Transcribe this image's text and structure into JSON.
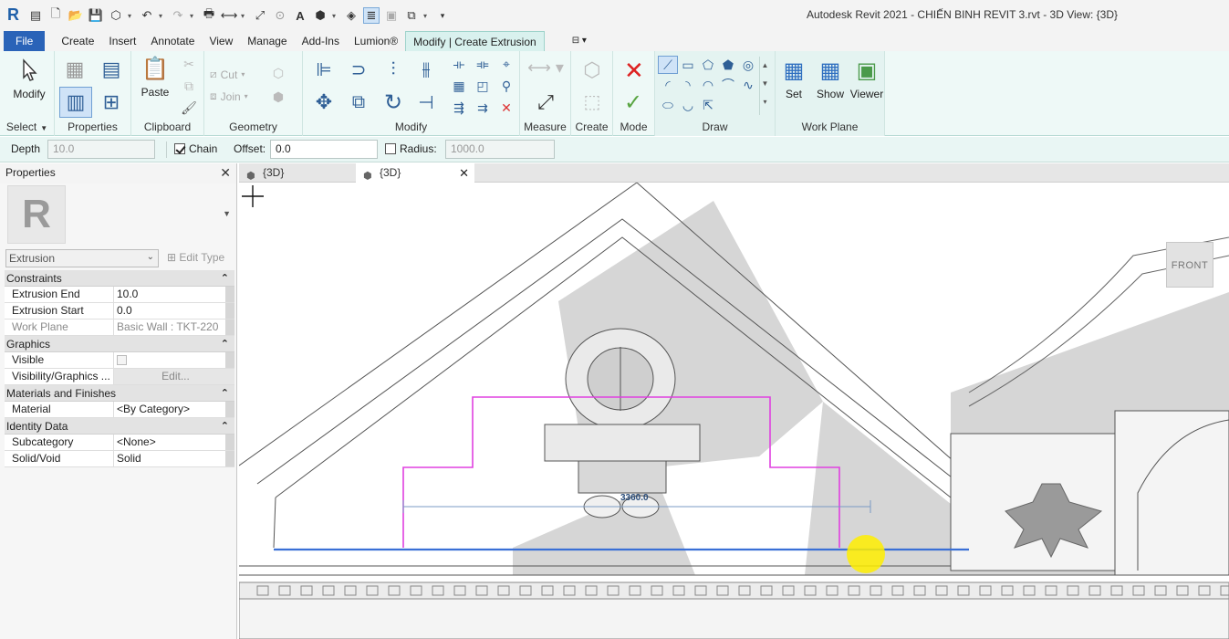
{
  "titlebar": {
    "app_icon": "revit-logo",
    "title": "Autodesk Revit 2021 - CHIẾN BINH REVIT 3.rvt - 3D View: {3D}",
    "qat_icons": [
      "open-icon",
      "save-icon",
      "sync-icon",
      "undo-icon",
      "redo-icon",
      "print-icon",
      "measure-icon",
      "text-icon",
      "3d-view-icon",
      "thin-lines-icon",
      "close-hidden-icon",
      "switch-windows-icon"
    ]
  },
  "ribbon_tabs": {
    "file": "File",
    "create": "Create",
    "insert": "Insert",
    "annotate": "Annotate",
    "view": "View",
    "manage": "Manage",
    "addins": "Add-Ins",
    "lumion": "Lumion®",
    "context": "Modify | Create Extrusion"
  },
  "ribbon": {
    "select": {
      "modify": "Modify",
      "label": "Select"
    },
    "properties": {
      "label": "Properties"
    },
    "clipboard": {
      "paste": "Paste",
      "label": "Clipboard"
    },
    "geometry": {
      "cut": "Cut",
      "join": "Join",
      "label": "Geometry"
    },
    "modify": {
      "label": "Modify"
    },
    "measure": {
      "label": "Measure"
    },
    "create": {
      "label": "Create"
    },
    "mode": {
      "label": "Mode"
    },
    "draw": {
      "label": "Draw"
    },
    "work_plane": {
      "set": "Set",
      "show": "Show",
      "viewer": "Viewer",
      "label": "Work Plane"
    }
  },
  "options_bar": {
    "depth_label": "Depth",
    "depth_value": "10.0",
    "chain_label": "Chain",
    "chain_checked": true,
    "offset_label": "Offset:",
    "offset_value": "0.0",
    "radius_label": "Radius:",
    "radius_checked": false,
    "radius_value": "1000.0"
  },
  "properties": {
    "title": "Properties",
    "thumb": "R",
    "type_name": "Extrusion",
    "edit_type": "Edit Type",
    "sections": [
      {
        "name": "Constraints",
        "rows": [
          {
            "key": "Extrusion End",
            "value": "10.0"
          },
          {
            "key": "Extrusion Start",
            "value": "0.0"
          },
          {
            "key": "Work Plane",
            "value": "Basic Wall : TKT-220"
          }
        ]
      },
      {
        "name": "Graphics",
        "rows": [
          {
            "key": "Visible",
            "value": ""
          },
          {
            "key": "Visibility/Graphics ...",
            "value": "Edit..."
          }
        ]
      },
      {
        "name": "Materials and Finishes",
        "rows": [
          {
            "key": "Material",
            "value": "<By Category>"
          }
        ]
      },
      {
        "name": "Identity Data",
        "rows": [
          {
            "key": "Subcategory",
            "value": "<None>"
          },
          {
            "key": "Solid/Void",
            "value": "Solid"
          }
        ]
      }
    ]
  },
  "view_tabs": [
    {
      "label": "{3D}",
      "active": false
    },
    {
      "label": "{3D}",
      "active": true
    }
  ],
  "canvas": {
    "dimension": "3360.0",
    "viewcube_face": "FRONT",
    "sketch_color": "#e040e0",
    "sketch_line_color": "#3a6fd6"
  },
  "colors": {
    "accent": "#2a63b8",
    "ribbon_bg": "#eef9f7",
    "context_tab": "#d9f1ee"
  }
}
